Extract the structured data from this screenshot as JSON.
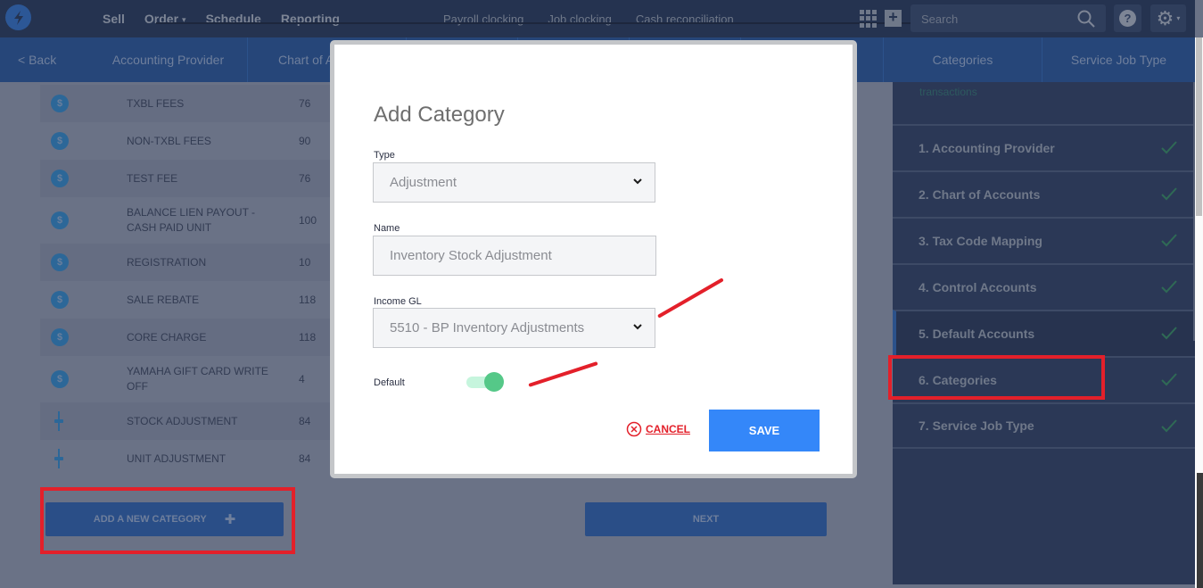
{
  "topbar": {
    "nav_main": [
      {
        "label": "Sell",
        "has_caret": false
      },
      {
        "label": "Order",
        "has_caret": true
      },
      {
        "label": "Schedule",
        "has_caret": false
      },
      {
        "label": "Reporting",
        "has_caret": false
      }
    ],
    "nav_secondary": [
      "Payroll clocking",
      "Job clocking",
      "Cash reconciliation"
    ],
    "search_placeholder": "Search",
    "help_glyph": "?",
    "gear_glyph": "⚙",
    "caret_glyph": "▾",
    "plus_glyph": "+"
  },
  "subnav": {
    "back_label": "< Back",
    "tabs": [
      "Accounting Provider",
      "Chart of Accounts",
      "Categories",
      "Service Job Type"
    ]
  },
  "categories": [
    {
      "icon": "dollar-icon",
      "name": "TXBL FEES",
      "num": "76"
    },
    {
      "icon": "dollar-icon",
      "name": "NON-TXBL FEES",
      "num": "90"
    },
    {
      "icon": "dollar-icon",
      "name": "TEST FEE",
      "num": "76"
    },
    {
      "icon": "dollar-icon",
      "name": "BALANCE LIEN PAYOUT - CASH PAID UNIT",
      "num": "100"
    },
    {
      "icon": "dollar-icon",
      "name": "REGISTRATION",
      "num": "10"
    },
    {
      "icon": "dollar-icon",
      "name": "SALE REBATE",
      "num": "118"
    },
    {
      "icon": "dollar-icon",
      "name": "CORE CHARGE",
      "num": "118"
    },
    {
      "icon": "dollar-icon",
      "name": "YAMAHA GIFT CARD WRITE OFF",
      "num": "4"
    },
    {
      "icon": "adjustment-icon",
      "name": "STOCK ADJUSTMENT",
      "num": "84"
    },
    {
      "icon": "adjustment-icon",
      "name": "UNIT ADJUSTMENT",
      "num": "84"
    }
  ],
  "dollar_glyph": "$",
  "buttons": {
    "add_category": "ADD A NEW CATEGORY",
    "add_plus": "✚",
    "next": "NEXT"
  },
  "sidebar": {
    "intro_text": "transactions",
    "steps": [
      {
        "label": "1. Accounting Provider",
        "complete": true,
        "active": false
      },
      {
        "label": "2. Chart of Accounts",
        "complete": true,
        "active": false
      },
      {
        "label": "3. Tax Code Mapping",
        "complete": true,
        "active": false
      },
      {
        "label": "4. Control Accounts",
        "complete": true,
        "active": false
      },
      {
        "label": "5. Default Accounts",
        "complete": true,
        "active": true
      },
      {
        "label": "6. Categories",
        "complete": true,
        "active": false
      },
      {
        "label": "7. Service Job Type",
        "complete": true,
        "active": false
      }
    ]
  },
  "modal": {
    "title": "Add Category",
    "type_label": "Type",
    "type_value": "Adjustment",
    "name_label": "Name",
    "name_value": "Inventory Stock Adjustment",
    "income_gl_label": "Income GL",
    "income_gl_value": "5510 - BP Inventory Adjustments",
    "default_label": "Default",
    "default_on": true,
    "cancel_label": "CANCEL",
    "save_label": "SAVE"
  },
  "colors": {
    "topbar": "#253350",
    "subnav": "#264679",
    "save": "#3487f9",
    "cancel": "#e3202a",
    "toggle_on": "#55c888",
    "annotation": "#e3202a"
  }
}
